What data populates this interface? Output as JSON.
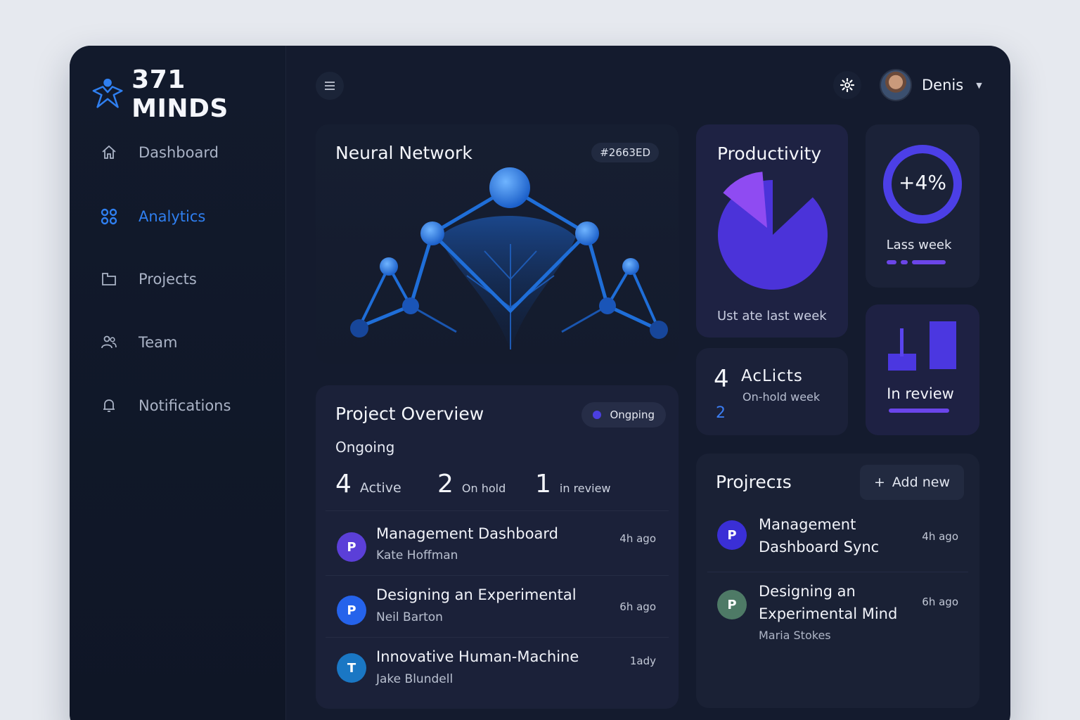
{
  "brand": {
    "name": "371 MINDS"
  },
  "sidebar": {
    "items": [
      {
        "label": "Dashboard",
        "icon": "home-icon"
      },
      {
        "label": "Analytics",
        "icon": "grid-icon",
        "active": true
      },
      {
        "label": "Projects",
        "icon": "folder-icon"
      },
      {
        "label": "Team",
        "icon": "users-icon"
      },
      {
        "label": "Notifications",
        "icon": "bell-icon"
      }
    ]
  },
  "header": {
    "user_name": "Denis"
  },
  "neural": {
    "title": "Neural Network",
    "badge": "#2663ED"
  },
  "productivity": {
    "title": "Productivity",
    "footer": "Ust ate last week",
    "share_small": 0.13,
    "color_main": "#4b33d9",
    "color_slice": "#8f4bf2"
  },
  "growth": {
    "value": "+4%",
    "label": "Lass week",
    "ring_fraction": 1.0,
    "accent": "#4c3fe6"
  },
  "actions": {
    "count": "4",
    "label": "AcLicts",
    "sub": "On-hold week",
    "count2": "2"
  },
  "review": {
    "label": "In review"
  },
  "overview": {
    "title": "Project Overview",
    "status": "Ongping",
    "subtitle": "Ongoing",
    "stats": [
      {
        "value": "4",
        "label": "Active"
      },
      {
        "value": "2",
        "label": "On hold"
      },
      {
        "value": "1",
        "label": "in review"
      }
    ],
    "rows": [
      {
        "initial": "P",
        "title": "Management Dashboard",
        "owner": "Kate Hoffman",
        "time": "4h ago",
        "color": "#5b3fd8"
      },
      {
        "initial": "P",
        "title": "Designing an Experimental",
        "owner": "Neil Barton",
        "time": "6h ago",
        "color": "#2563eb"
      },
      {
        "initial": "T",
        "title": "Innovative Human-Machine",
        "owner": "Jake Blundell",
        "time": "1ady",
        "color": "#1a77c4"
      }
    ]
  },
  "projects": {
    "title": "Projrecɪs",
    "add_label": "Add new",
    "items": [
      {
        "initial": "P",
        "title_line1": "Management",
        "title_line2": "Dashboard Sync",
        "owner": "",
        "time": "4h ago",
        "color": "#3a2fd6"
      },
      {
        "initial": "P",
        "title_line1": "Designing an",
        "title_line2": "Experimental Mind",
        "owner": "Maria Stokes",
        "time": "6h ago",
        "color": "#4e7a66"
      }
    ]
  }
}
